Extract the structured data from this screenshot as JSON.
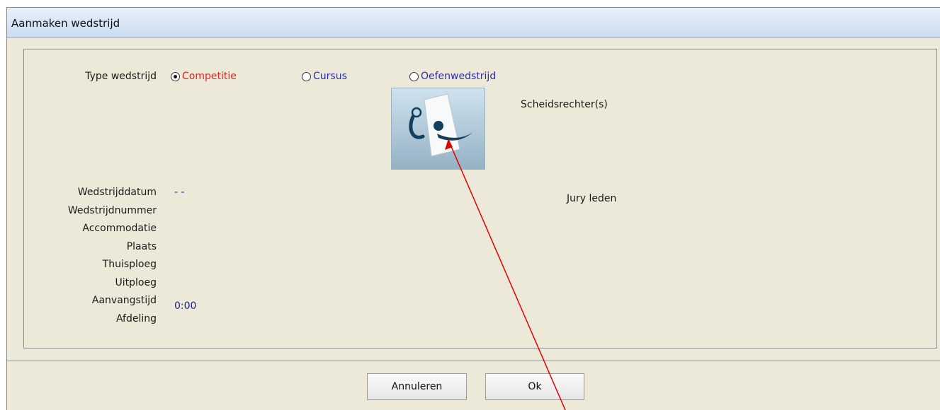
{
  "window": {
    "title": "Aanmaken wedstrijd"
  },
  "type_row": {
    "label": "Type wedstrijd",
    "options": [
      {
        "label": "Competitie",
        "selected": true,
        "color": "#e8201a"
      },
      {
        "label": "Cursus",
        "selected": false,
        "color": "#2b2bb0"
      },
      {
        "label": "Oefenwedstrijd",
        "selected": false,
        "color": "#2b2bb0"
      }
    ]
  },
  "referee": {
    "label": "Scheidsrechter(s)",
    "icon": "referee-whistle-card-icon"
  },
  "jury": {
    "label": "Jury leden"
  },
  "fields": [
    {
      "label": "Wedstrijddatum",
      "value": "- -"
    },
    {
      "label": "Wedstrijdnummer",
      "value": ""
    },
    {
      "label": "Accommodatie",
      "value": ""
    },
    {
      "label": "Plaats",
      "value": ""
    },
    {
      "label": "Thuisploeg",
      "value": ""
    },
    {
      "label": "Uitploeg",
      "value": ""
    },
    {
      "label": "Aanvangstijd",
      "value": "0:00"
    },
    {
      "label": "Afdeling",
      "value": ""
    }
  ],
  "buttons": {
    "cancel": "Annuleren",
    "ok": "Ok"
  },
  "annotation": {
    "color": "#e00000"
  }
}
